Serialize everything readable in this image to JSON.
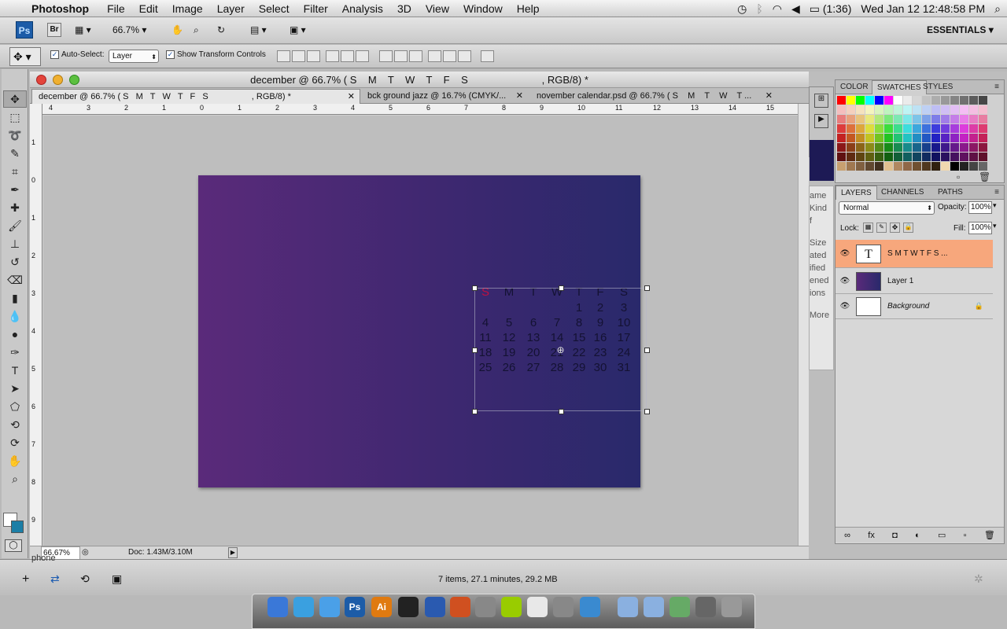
{
  "menubar": {
    "app_name": "Photoshop",
    "items": [
      "File",
      "Edit",
      "Image",
      "Layer",
      "Select",
      "Filter",
      "Analysis",
      "3D",
      "View",
      "Window",
      "Help"
    ],
    "battery": "(1:36)",
    "clock": "Wed Jan 12  12:48:58 PM"
  },
  "appbar": {
    "ps_badge": "Ps",
    "br_badge": "Br",
    "zoom": "66.7%",
    "workspace": "ESSENTIALS"
  },
  "options": {
    "auto_select_label": "Auto-Select:",
    "auto_select_value": "Layer",
    "show_transform_label": "Show Transform Controls"
  },
  "document": {
    "window_title": "december @ 66.7% ( S    M    T    W    T    F    S                          , RGB/8) *",
    "tabs": [
      {
        "label": "december @ 66.7% ( S   M   T   W   T   F   S                  , RGB/8) *"
      },
      {
        "label": "bck ground jazz @ 16.7% (CMYK/..."
      },
      {
        "label": "november calendar.psd @ 66.7% ( S    M    T    W    T ..."
      }
    ],
    "ruler_h": [
      "4",
      "3",
      "2",
      "1",
      "0",
      "1",
      "2",
      "3",
      "4",
      "5",
      "6",
      "7",
      "8",
      "9",
      "10",
      "11",
      "12",
      "13",
      "14",
      "15"
    ],
    "ruler_v": [
      "1",
      "0",
      "1",
      "2",
      "3",
      "4",
      "5",
      "6",
      "7",
      "8",
      "9"
    ],
    "status_zoom": "66.67%",
    "status_doc": "Doc: 1.43M/3.10M"
  },
  "calendar": {
    "weekdays": [
      "S",
      "M",
      "T",
      "W",
      "T",
      "F",
      "S"
    ],
    "weekday_highlight_color": "#c01040",
    "rows": [
      [
        "",
        "",
        "",
        "",
        "1",
        "2",
        "3"
      ],
      [
        "4",
        "5",
        "6",
        "7",
        "8",
        "9",
        "10"
      ],
      [
        "11",
        "12",
        "13",
        "14",
        "15",
        "16",
        "17"
      ],
      [
        "18",
        "19",
        "20",
        "21",
        "22",
        "23",
        "24"
      ],
      [
        "25",
        "26",
        "27",
        "28",
        "29",
        "30",
        "31"
      ]
    ]
  },
  "panels": {
    "swatch_tabs": [
      "COLOR",
      "SWATCHES",
      "STYLES"
    ],
    "layer_tabs": [
      "LAYERS",
      "CHANNELS",
      "PATHS"
    ],
    "blend_mode": "Normal",
    "opacity_label": "Opacity:",
    "opacity_value": "100%",
    "lock_label": "Lock:",
    "fill_label": "Fill:",
    "fill_value": "100%",
    "layers": [
      {
        "name": "S  M  T  W  T  F  S  ...",
        "type": "text",
        "thumb_text": "T"
      },
      {
        "name": "Layer 1",
        "type": "pixel"
      },
      {
        "name": "Background",
        "type": "background"
      }
    ],
    "behind_text": [
      "ame",
      "Kind",
      "f",
      "Size",
      "ated",
      "ified",
      "ened",
      "ions",
      "More"
    ]
  },
  "finder_status": "7 items, 27.1 minutes, 29.2 MB",
  "finder_left": "phone",
  "dock_icons": [
    "finder-icon",
    "safari-icon",
    "itunes-icon",
    "Ps",
    "Ai",
    "dvd-icon",
    "word-icon",
    "powerpoint-icon",
    "preview-icon",
    "app-icon",
    "chrome-icon",
    "utility-icon",
    "messenger-icon",
    "folder-icon",
    "folder-icon",
    "torrent-icon",
    "dashboard-icon",
    "trash-icon"
  ],
  "colors": {
    "canvas_left": "#5a2a7a",
    "canvas_right": "#29296b",
    "selected_layer": "#f7a77c"
  }
}
